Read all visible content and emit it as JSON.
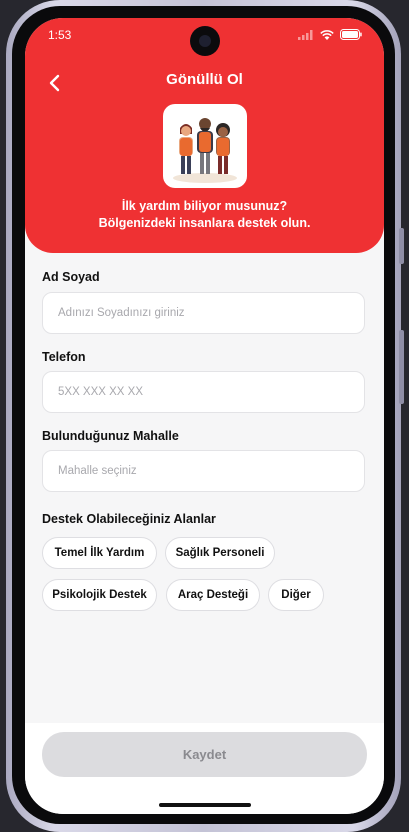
{
  "status_bar": {
    "time": "1:53"
  },
  "header": {
    "title": "Gönüllü Ol",
    "subtitle_line1": "İlk yardım biliyor musunuz?",
    "subtitle_line2": "Bölgenizdeki insanlara destek olun."
  },
  "form": {
    "name": {
      "label": "Ad Soyad",
      "placeholder": "Adınızı Soyadınızı giriniz",
      "value": ""
    },
    "phone": {
      "label": "Telefon",
      "placeholder": "5XX XXX XX XX",
      "value": ""
    },
    "neighborhood": {
      "label": "Bulunduğunuz Mahalle",
      "placeholder": "Mahalle seçiniz",
      "value": ""
    },
    "areas": {
      "label": "Destek Olabileceğiniz Alanlar",
      "options": [
        "Temel İlk Yardım",
        "Sağlık Personeli",
        "Psikolojik Destek",
        "Araç Desteği",
        "Diğer"
      ]
    }
  },
  "footer": {
    "save_label": "Kaydet"
  },
  "colors": {
    "primary": "#ef3133",
    "disabled_button": "#dcdcdf",
    "background": "#f6f6f7"
  },
  "icons": {
    "back": "chevron-left-icon",
    "signal": "signal-icon",
    "wifi": "wifi-icon",
    "battery": "battery-icon"
  }
}
